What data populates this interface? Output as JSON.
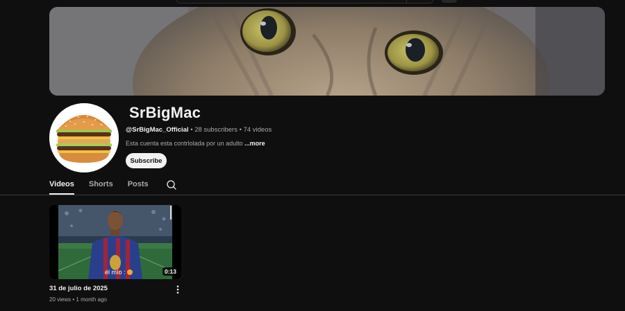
{
  "channel": {
    "name": "SrBigMac",
    "handle": "@SrBigMac_Official",
    "separator": "•",
    "subscribers": "28 subscribers",
    "videos_count": "74 videos",
    "description": "Esta cuenta esta contrlolada por un adulto",
    "more_label": "...more",
    "subscribe_label": "Subscribe"
  },
  "tabs": [
    {
      "label": "Videos",
      "active": true
    },
    {
      "label": "Shorts",
      "active": false
    },
    {
      "label": "Posts",
      "active": false
    }
  ],
  "icons": {
    "search": "search-icon",
    "more": "more-vert-icon"
  },
  "videos": [
    {
      "title": "31 de julio de 2025",
      "views": "20 views",
      "age": "1 month ago",
      "duration": "0:13",
      "caption": "él mío :"
    }
  ],
  "colors": {
    "background": "#0f0f0f",
    "text_primary": "#f1f1f1",
    "text_secondary": "#aaaaaa",
    "subscribe_bg": "#f1f1f1"
  }
}
